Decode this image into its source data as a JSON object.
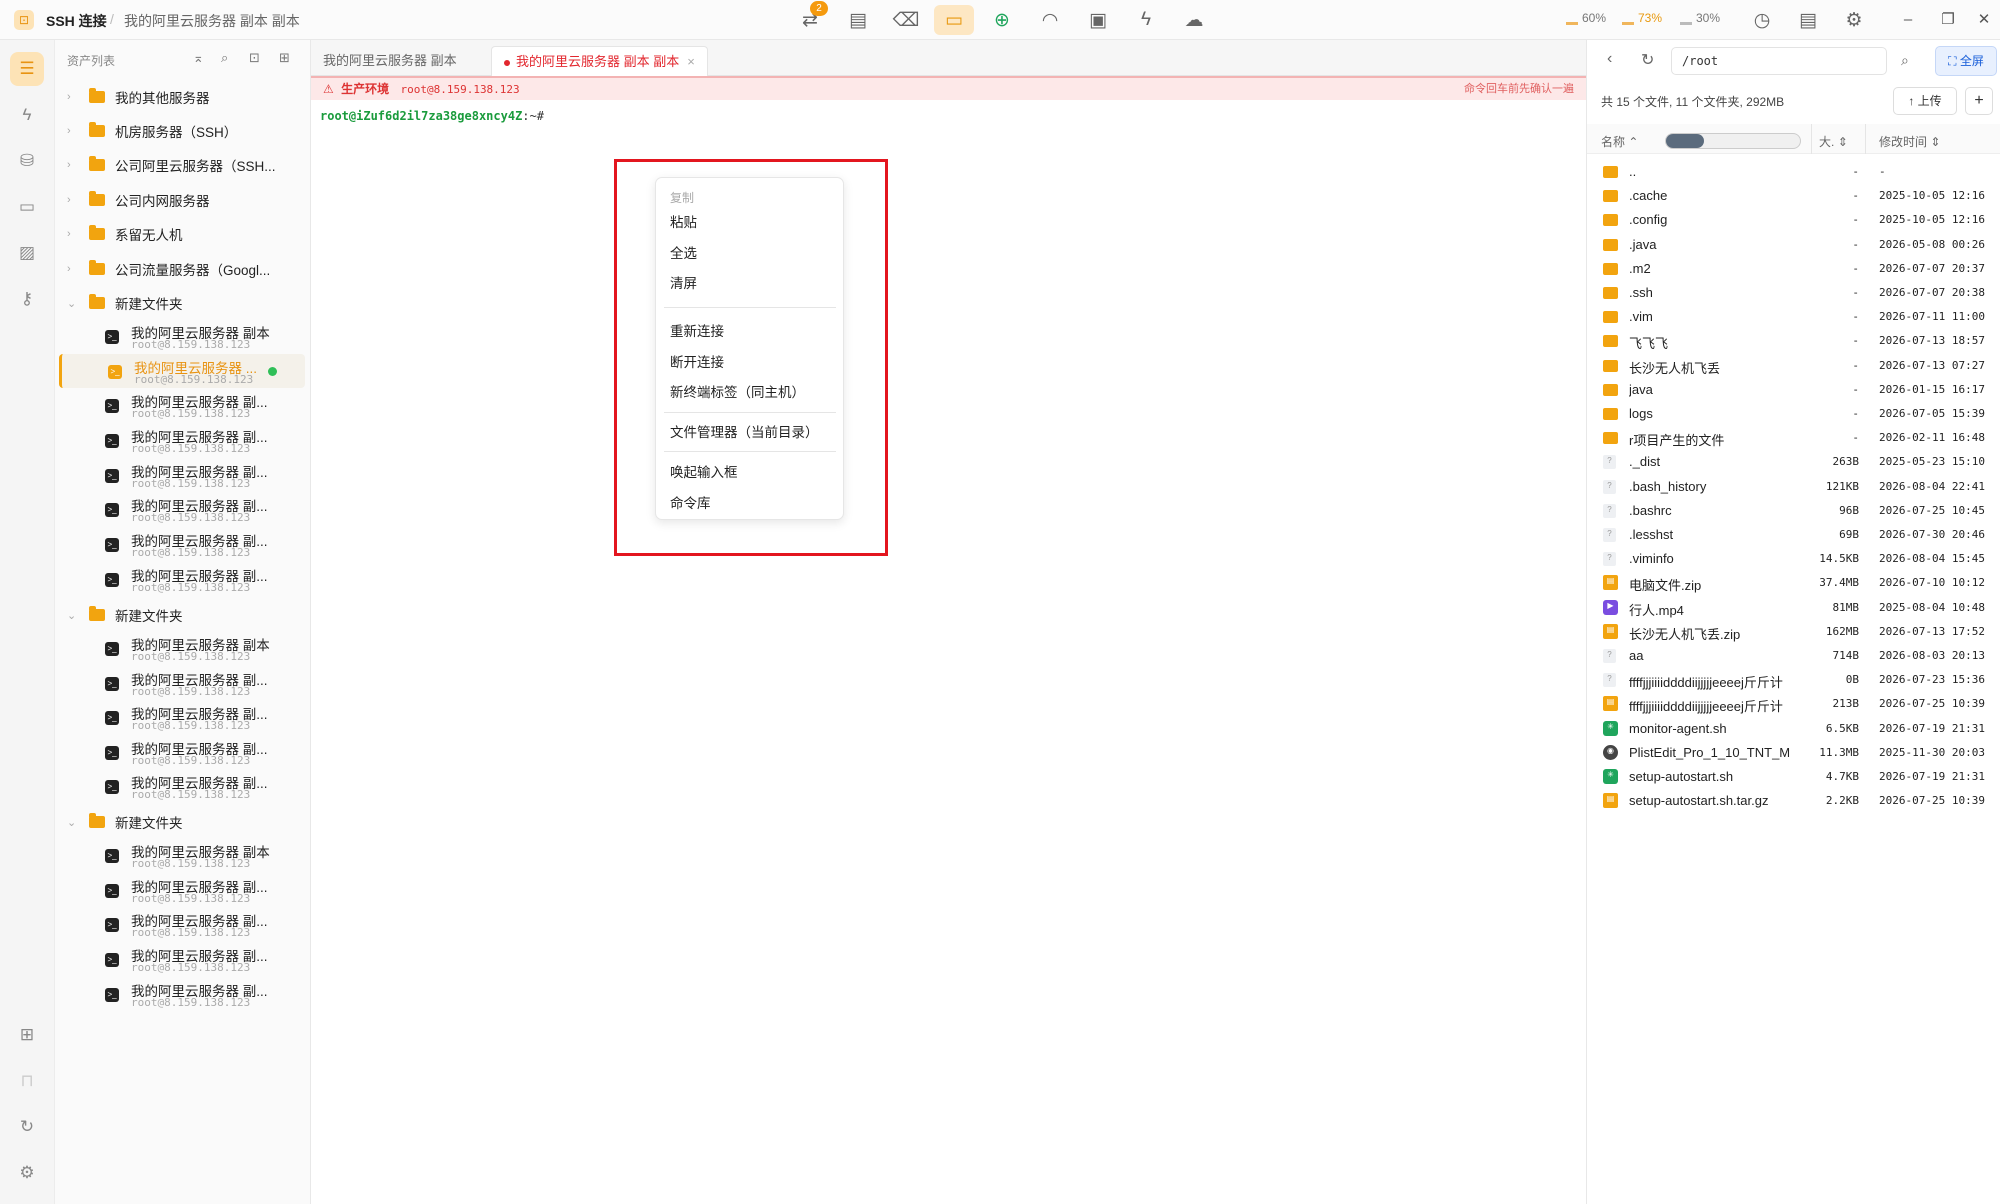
{
  "titlebar": {
    "app_title": "SSH 连接",
    "separator": "/",
    "breadcrumb": "我的阿里云服务器 副本 副本",
    "notification_count": "2",
    "metrics": [
      {
        "label": "60%"
      },
      {
        "label": "73%"
      },
      {
        "label": "30%"
      }
    ]
  },
  "assets": {
    "title": "资产列表",
    "folders": [
      {
        "name": "我的其他服务器"
      },
      {
        "name": "机房服务器（SSH）"
      },
      {
        "name": "公司阿里云服务器（SSH..."
      },
      {
        "name": "公司内网服务器"
      },
      {
        "name": "系留无人机"
      },
      {
        "name": "公司流量服务器（Googl..."
      },
      {
        "name": "新建文件夹"
      },
      {
        "name": "新建文件夹"
      },
      {
        "name": "新建文件夹"
      }
    ],
    "hosts": [
      {
        "name": "我的阿里云服务器 副本",
        "addr": "root@8.159.138.123"
      },
      {
        "name": "我的阿里云服务器 ...",
        "addr": "root@8.159.138.123"
      },
      {
        "name": "我的阿里云服务器 副...",
        "addr": "root@8.159.138.123"
      },
      {
        "name": "我的阿里云服务器 副...",
        "addr": "root@8.159.138.123"
      },
      {
        "name": "我的阿里云服务器 副...",
        "addr": "root@8.159.138.123"
      },
      {
        "name": "我的阿里云服务器 副...",
        "addr": "root@8.159.138.123"
      },
      {
        "name": "我的阿里云服务器 副...",
        "addr": "root@8.159.138.123"
      },
      {
        "name": "我的阿里云服务器 副...",
        "addr": "root@8.159.138.123"
      },
      {
        "name": "我的阿里云服务器 副本",
        "addr": "root@8.159.138.123"
      },
      {
        "name": "我的阿里云服务器 副...",
        "addr": "root@8.159.138.123"
      },
      {
        "name": "我的阿里云服务器 副...",
        "addr": "root@8.159.138.123"
      },
      {
        "name": "我的阿里云服务器 副...",
        "addr": "root@8.159.138.123"
      },
      {
        "name": "我的阿里云服务器 副...",
        "addr": "root@8.159.138.123"
      },
      {
        "name": "我的阿里云服务器 副本",
        "addr": "root@8.159.138.123"
      },
      {
        "name": "我的阿里云服务器 副...",
        "addr": "root@8.159.138.123"
      },
      {
        "name": "我的阿里云服务器 副...",
        "addr": "root@8.159.138.123"
      },
      {
        "name": "我的阿里云服务器 副...",
        "addr": "root@8.159.138.123"
      },
      {
        "name": "我的阿里云服务器 副...",
        "addr": "root@8.159.138.123"
      }
    ]
  },
  "terminal": {
    "tabs": [
      {
        "label": "我的阿里云服务器 副本"
      },
      {
        "label": "我的阿里云服务器 副本 副本",
        "close": "×"
      }
    ],
    "prod_label": "生产环境",
    "prod_host": "root@8.159.138.123",
    "prod_hint": "命令回车前先确认一遍",
    "prompt_user": "root@iZuf6d2il7za38ge8xncy4Z",
    "prompt_rest": ":~#"
  },
  "context_menu": {
    "items": [
      "复制",
      "粘贴",
      "全选",
      "清屏",
      "重新连接",
      "断开连接",
      "新终端标签（同主机）",
      "文件管理器（当前目录）",
      "唤起输入框",
      "命令库"
    ]
  },
  "files": {
    "path": "/root",
    "fullscreen": "全屏",
    "summary": "共 15 个文件, 11 个文件夹, 292MB",
    "upload": "上传",
    "add": "+",
    "col_name": "名称",
    "col_size": "大.",
    "col_time": "修改时间",
    "rows": [
      {
        "name": "..",
        "size": "-",
        "time": "-",
        "type": "folder"
      },
      {
        "name": ".cache",
        "size": "-",
        "time": "2025-10-05 12:16",
        "type": "folder"
      },
      {
        "name": ".config",
        "size": "-",
        "time": "2025-10-05 12:16",
        "type": "folder"
      },
      {
        "name": ".java",
        "size": "-",
        "time": "2026-05-08 00:26",
        "type": "folder"
      },
      {
        "name": ".m2",
        "size": "-",
        "time": "2026-07-07 20:37",
        "type": "folder"
      },
      {
        "name": ".ssh",
        "size": "-",
        "time": "2026-07-07 20:38",
        "type": "folder"
      },
      {
        "name": ".vim",
        "size": "-",
        "time": "2026-07-11 11:00",
        "type": "folder"
      },
      {
        "name": "飞飞飞",
        "size": "-",
        "time": "2026-07-13 18:57",
        "type": "folder"
      },
      {
        "name": "长沙无人机飞丢",
        "size": "-",
        "time": "2026-07-13 07:27",
        "type": "folder"
      },
      {
        "name": "java",
        "size": "-",
        "time": "2026-01-15 16:17",
        "type": "folder"
      },
      {
        "name": "logs",
        "size": "-",
        "time": "2026-07-05 15:39",
        "type": "folder"
      },
      {
        "name": "r项目产生的文件",
        "size": "-",
        "time": "2026-02-11 16:48",
        "type": "folder"
      },
      {
        "name": "._dist",
        "size": "263B",
        "time": "2025-05-23 15:10",
        "type": "unk"
      },
      {
        "name": ".bash_history",
        "size": "121KB",
        "time": "2026-08-04 22:41",
        "type": "unk"
      },
      {
        "name": ".bashrc",
        "size": "96B",
        "time": "2026-07-25 10:45",
        "type": "unk"
      },
      {
        "name": ".lesshst",
        "size": "69B",
        "time": "2026-07-30 20:46",
        "type": "unk"
      },
      {
        "name": ".viminfo",
        "size": "14.5KB",
        "time": "2026-08-04 15:45",
        "type": "unk"
      },
      {
        "name": "电脑文件.zip",
        "size": "37.4MB",
        "time": "2026-07-10 10:12",
        "type": "zip"
      },
      {
        "name": "行人.mp4",
        "size": "81MB",
        "time": "2025-08-04 10:48",
        "type": "mp4"
      },
      {
        "name": "长沙无人机飞丢.zip",
        "size": "162MB",
        "time": "2026-07-13 17:52",
        "type": "zip"
      },
      {
        "name": "aa",
        "size": "714B",
        "time": "2026-08-03 20:13",
        "type": "unk"
      },
      {
        "name": "ffffjjjiiiiddddiijjjjjeeeej斤斤计",
        "size": "0B",
        "time": "2026-07-23 15:36",
        "type": "unk"
      },
      {
        "name": "ffffjjjiiiiddddiijjjjjeeeej斤斤计",
        "size": "213B",
        "time": "2026-07-25 10:39",
        "type": "zip"
      },
      {
        "name": "monitor-agent.sh",
        "size": "6.5KB",
        "time": "2026-07-19 21:31",
        "type": "sh"
      },
      {
        "name": "PlistEdit_Pro_1_10_TNT_M",
        "size": "11.3MB",
        "time": "2025-11-30 20:03",
        "type": "app"
      },
      {
        "name": "setup-autostart.sh",
        "size": "4.7KB",
        "time": "2026-07-19 21:31",
        "type": "sh"
      },
      {
        "name": "setup-autostart.sh.tar.gz",
        "size": "2.2KB",
        "time": "2026-07-25 10:39",
        "type": "zip"
      }
    ]
  },
  "colors": {
    "accent": "#f2a40f",
    "danger": "#e2272e",
    "online": "#2fbf58",
    "prompt": "#1a9b3c"
  }
}
